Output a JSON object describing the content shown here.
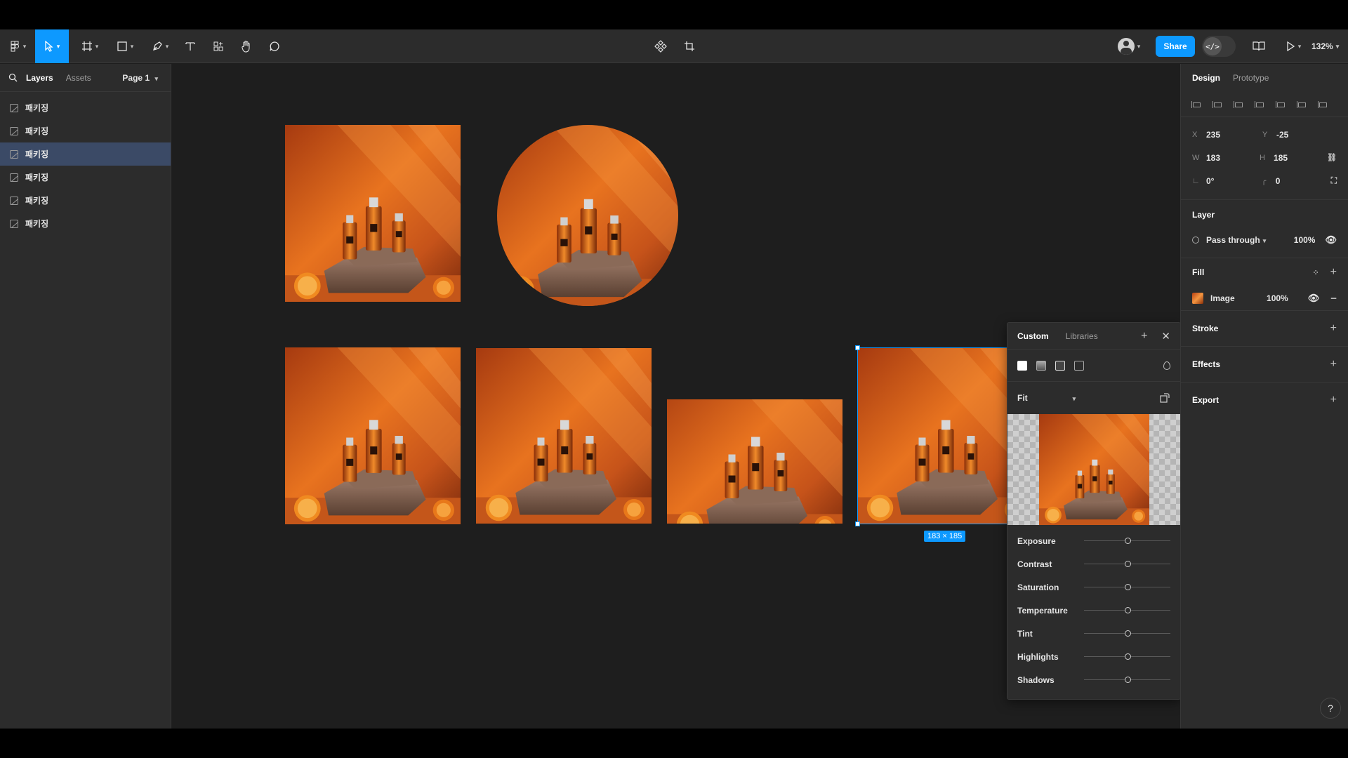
{
  "toolbar": {
    "share_label": "Share",
    "zoom": "132%",
    "code_toggle_label": "</>"
  },
  "left_panel": {
    "tabs": [
      "Layers",
      "Assets"
    ],
    "page": "Page 1",
    "layers": [
      "패키징",
      "패키징",
      "패키징",
      "패키징",
      "패키징",
      "패키징"
    ],
    "selected_index": 2
  },
  "canvas": {
    "selection_size": "183 × 185"
  },
  "fill_popover": {
    "tabs": [
      "Custom",
      "Libraries"
    ],
    "scale_mode": "Fit",
    "adjustments": [
      {
        "label": "Exposure",
        "value": 0
      },
      {
        "label": "Contrast",
        "value": 0
      },
      {
        "label": "Saturation",
        "value": 0
      },
      {
        "label": "Temperature",
        "value": 0
      },
      {
        "label": "Tint",
        "value": 0
      },
      {
        "label": "Highlights",
        "value": 0
      },
      {
        "label": "Shadows",
        "value": 0
      }
    ]
  },
  "right_panel": {
    "tabs": [
      "Design",
      "Prototype"
    ],
    "x": "235",
    "y": "-25",
    "w": "183",
    "h": "185",
    "rotation": "0°",
    "radius": "0",
    "labels": {
      "x": "X",
      "y": "Y",
      "w": "W",
      "h": "H"
    },
    "layer_section": "Layer",
    "blend_mode": "Pass through",
    "layer_opacity": "100%",
    "fill_section": "Fill",
    "fill_type": "Image",
    "fill_opacity": "100%",
    "stroke_section": "Stroke",
    "effects_section": "Effects",
    "export_section": "Export"
  },
  "colors": {
    "accent": "#0d99ff",
    "panel": "#2c2c2c",
    "canvas": "#1e1e1e",
    "selected_layer": "#3b4a66"
  }
}
